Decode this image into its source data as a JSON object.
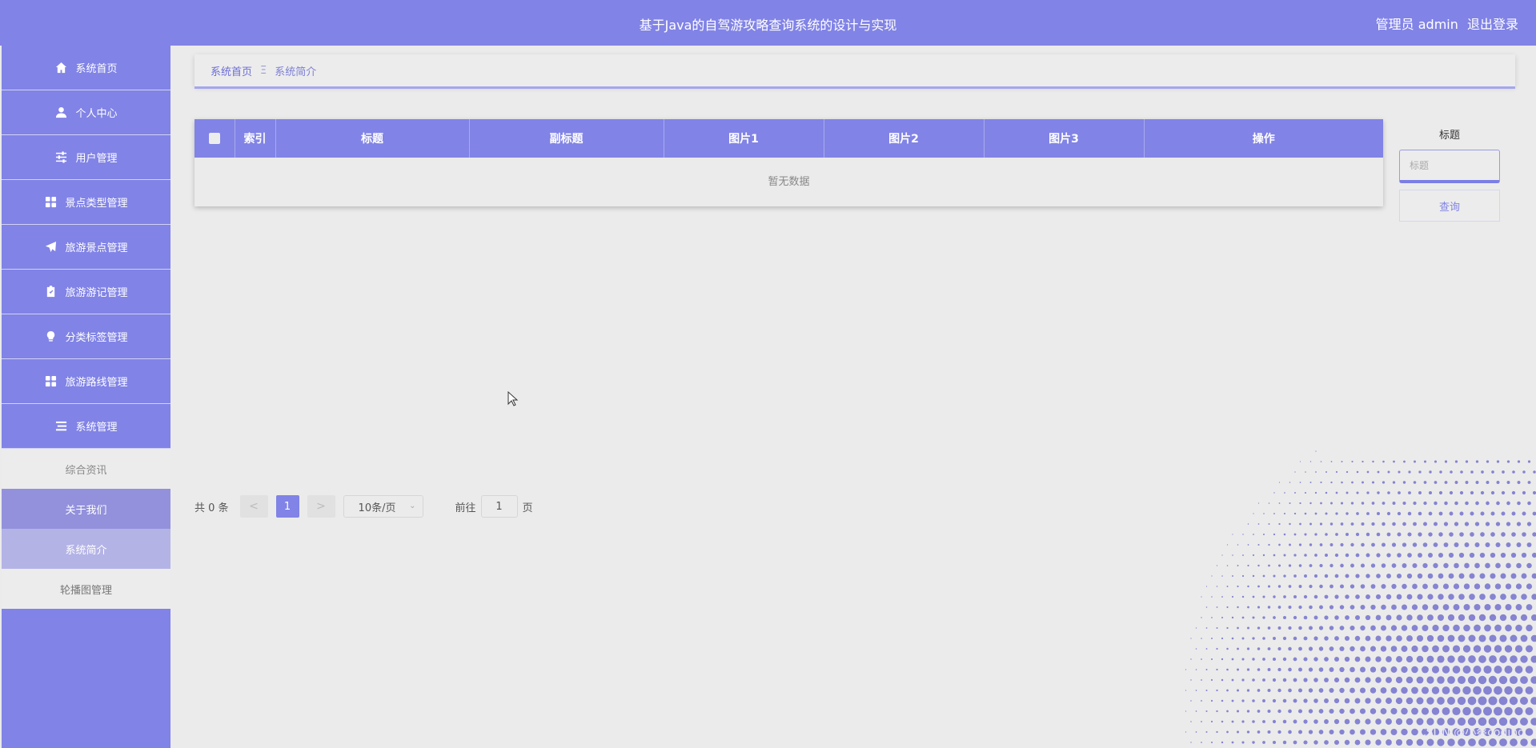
{
  "header": {
    "title": "基于Java的自驾游攻略查询系统的设计与实现",
    "user_label": "管理员 admin",
    "logout": "退出登录"
  },
  "sidebar": {
    "items": [
      {
        "label": "系统首页",
        "icon": "home-icon"
      },
      {
        "label": "个人中心",
        "icon": "user-icon"
      },
      {
        "label": "用户管理",
        "icon": "sliders-icon"
      },
      {
        "label": "景点类型管理",
        "icon": "grid-icon"
      },
      {
        "label": "旅游景点管理",
        "icon": "paper-plane-icon"
      },
      {
        "label": "旅游游记管理",
        "icon": "clipboard-icon"
      },
      {
        "label": "分类标签管理",
        "icon": "lightbulb-icon"
      },
      {
        "label": "旅游路线管理",
        "icon": "grid-icon"
      },
      {
        "label": "系统管理",
        "icon": "list-icon"
      }
    ],
    "submenu": [
      "综合资讯",
      "关于我们",
      "系统简介",
      "轮播图管理"
    ],
    "active_sub": "系统简介"
  },
  "breadcrumb": {
    "home": "系统首页",
    "separator": "Ξ",
    "current": "系统简介"
  },
  "table": {
    "columns": [
      "索引",
      "标题",
      "副标题",
      "图片1",
      "图片2",
      "图片3",
      "操作"
    ],
    "rows": [],
    "empty_text": "暂无数据"
  },
  "search": {
    "label": "标题",
    "placeholder": "标题",
    "button": "查询"
  },
  "pagination": {
    "total": "共 0 条",
    "prev": "<",
    "current_page": "1",
    "next": ">",
    "page_size": "10条/页",
    "goto_label": "前往",
    "goto_value": "1",
    "page_suffix": "页"
  },
  "watermark": "CSDN @小蔡coding",
  "colors": {
    "primary": "#8183e6",
    "background": "#ebebeb",
    "active_sub": "#b4b3e6"
  }
}
